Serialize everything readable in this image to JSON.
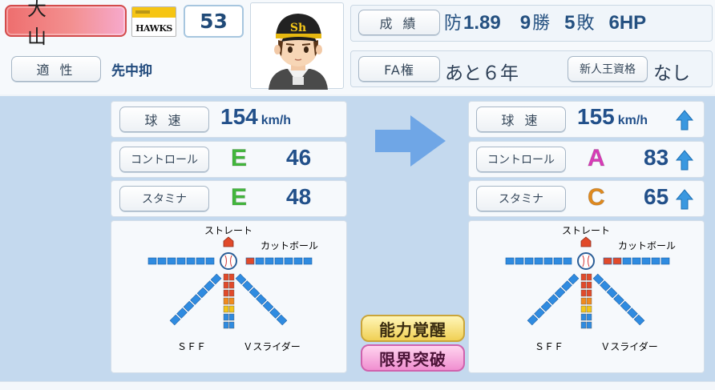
{
  "player": {
    "name": "大 山",
    "team_logo_text": "HAWKS",
    "number": "53"
  },
  "aptitude": {
    "label": "適 性",
    "value": "先中抑"
  },
  "record": {
    "label": "成 績",
    "era_prefix": "防",
    "era": "1.89",
    "wins_num": "9",
    "wins_unit": "勝",
    "losses_num": "5",
    "losses_unit": "敗",
    "holds": "6HP"
  },
  "fa": {
    "label": "FA権",
    "value": "あと６年"
  },
  "rookie": {
    "label": "新人王資格",
    "value": "なし"
  },
  "before": {
    "speed_label": "球 速",
    "speed": "154",
    "speed_unit": "km/h",
    "control_label": "コントロール",
    "control_grade": "E",
    "control_value": "46",
    "stamina_label": "スタミナ",
    "stamina_grade": "E",
    "stamina_value": "48"
  },
  "after": {
    "speed_label": "球 速",
    "speed": "155",
    "speed_unit": "km/h",
    "control_label": "コントロール",
    "control_grade": "A",
    "control_value": "83",
    "stamina_label": "スタミナ",
    "stamina_grade": "C",
    "stamina_value": "65"
  },
  "pitches": {
    "straight": "ストレート",
    "cutball": "カットボール",
    "sff": "ＳＦＦ",
    "vslider": "Ｖスライダー"
  },
  "buttons": {
    "awaken": "能力覚醒",
    "limit_break": "限界突破"
  },
  "colors": {
    "grade_E": "#42b83c",
    "grade_A": "#d93bb8",
    "grade_C": "#e08a1e",
    "arrow_up": "#3a98e0",
    "transition_arrow": "#6fa6e6",
    "pitch_seg": "#2f8be0",
    "pitch_red": "#e14a2a",
    "pitch_orange": "#f08a1e",
    "pitch_yellow": "#f2c51a"
  },
  "pitch_levels": {
    "before": {
      "straight": 1,
      "cutball": 1,
      "sff": 0,
      "vslider": 0,
      "fork": 5
    },
    "after": {
      "straight": 1,
      "cutball": 2,
      "sff": 0,
      "vslider": 0,
      "fork": 5
    }
  }
}
